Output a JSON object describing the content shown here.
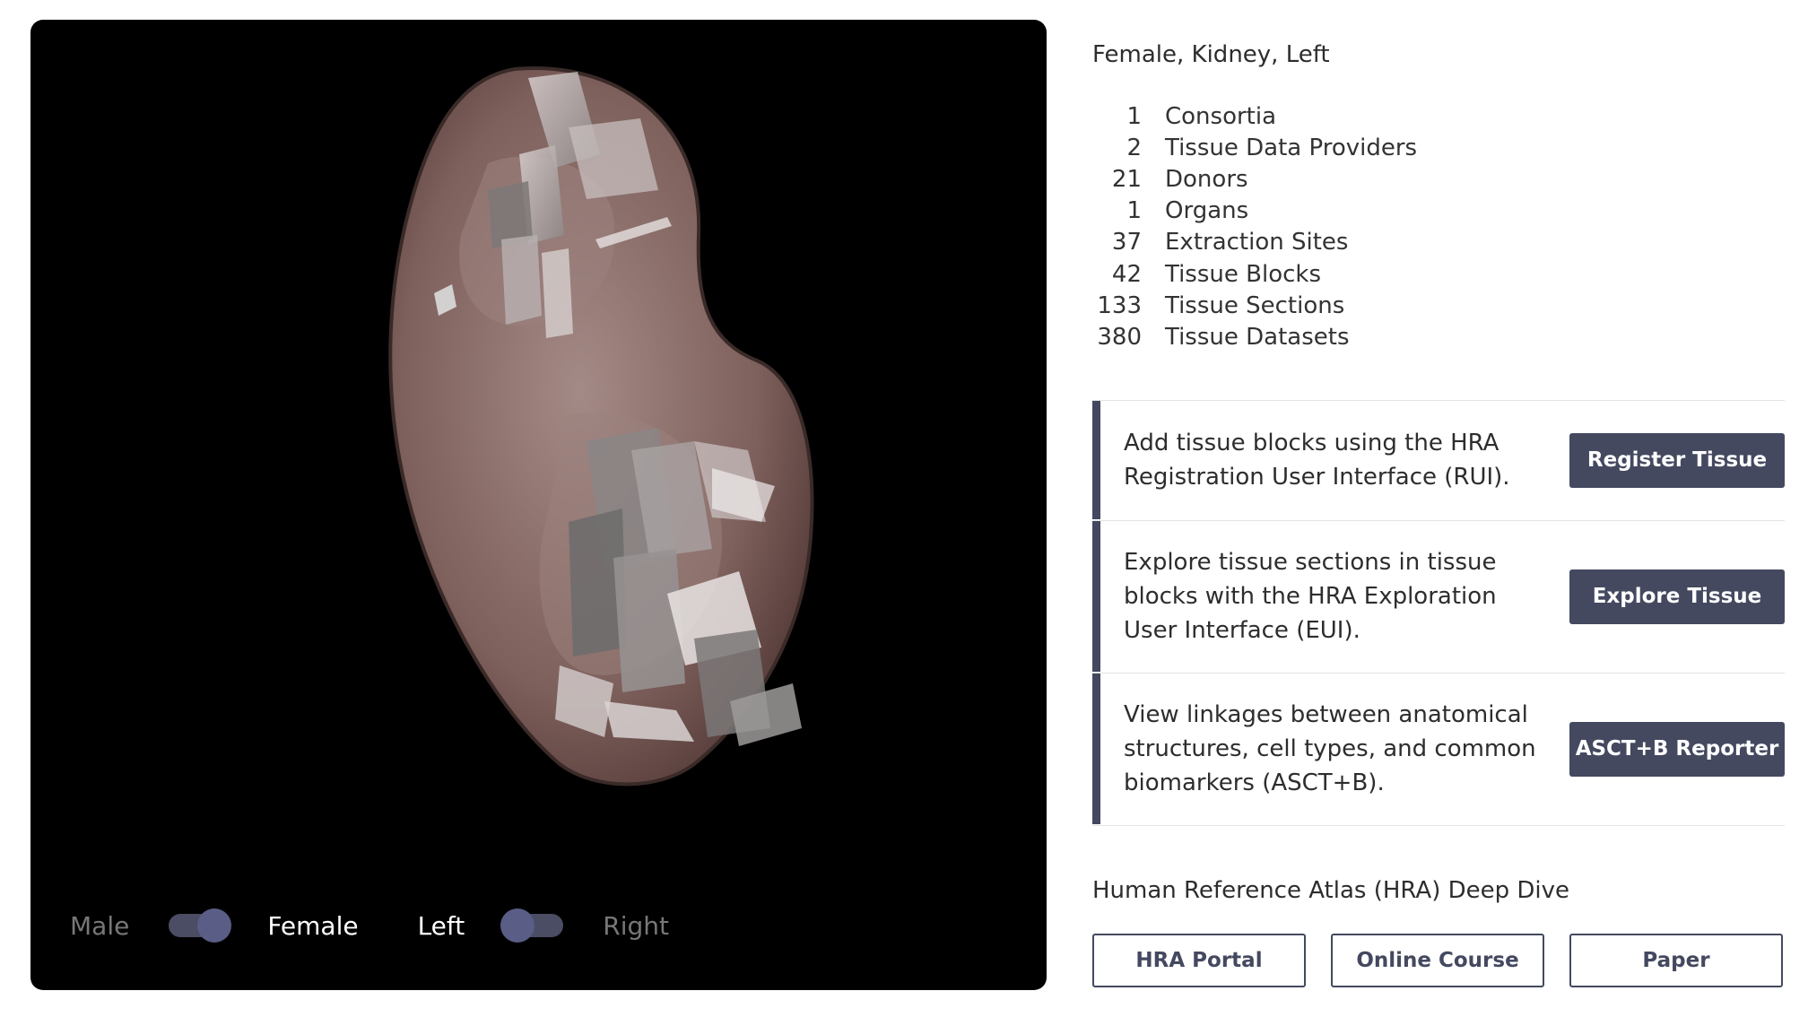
{
  "viewer": {
    "toggles": {
      "sex": {
        "left_label": "Male",
        "right_label": "Female",
        "selected": "Female"
      },
      "side": {
        "left_label": "Left",
        "right_label": "Right",
        "selected": "Left"
      }
    }
  },
  "panel": {
    "selection_title": "Female, Kidney, Left",
    "stats": [
      {
        "count": "1",
        "label": "Consortia"
      },
      {
        "count": "2",
        "label": "Tissue Data Providers"
      },
      {
        "count": "21",
        "label": "Donors"
      },
      {
        "count": "1",
        "label": "Organs"
      },
      {
        "count": "37",
        "label": "Extraction Sites"
      },
      {
        "count": "42",
        "label": "Tissue Blocks"
      },
      {
        "count": "133",
        "label": "Tissue Sections"
      },
      {
        "count": "380",
        "label": "Tissue Datasets"
      }
    ],
    "actions": [
      {
        "text": "Add tissue blocks using the HRA Registration User Interface (RUI).",
        "button": "Register Tissue"
      },
      {
        "text": "Explore tissue sections in tissue blocks with the HRA Exploration User Interface (EUI).",
        "button": "Explore Tissue"
      },
      {
        "text": "View linkages between anatomical structures, cell types, and common biomarkers (ASCT+B).",
        "button": "ASCT+B Reporter"
      }
    ],
    "deep_dive": {
      "title": "Human Reference Atlas (HRA) Deep Dive",
      "links": [
        "HRA Portal",
        "Online Course",
        "Paper"
      ]
    }
  },
  "colors": {
    "accent": "#434860",
    "viewer_bg": "#000000",
    "organ": "#6b4f4c"
  }
}
